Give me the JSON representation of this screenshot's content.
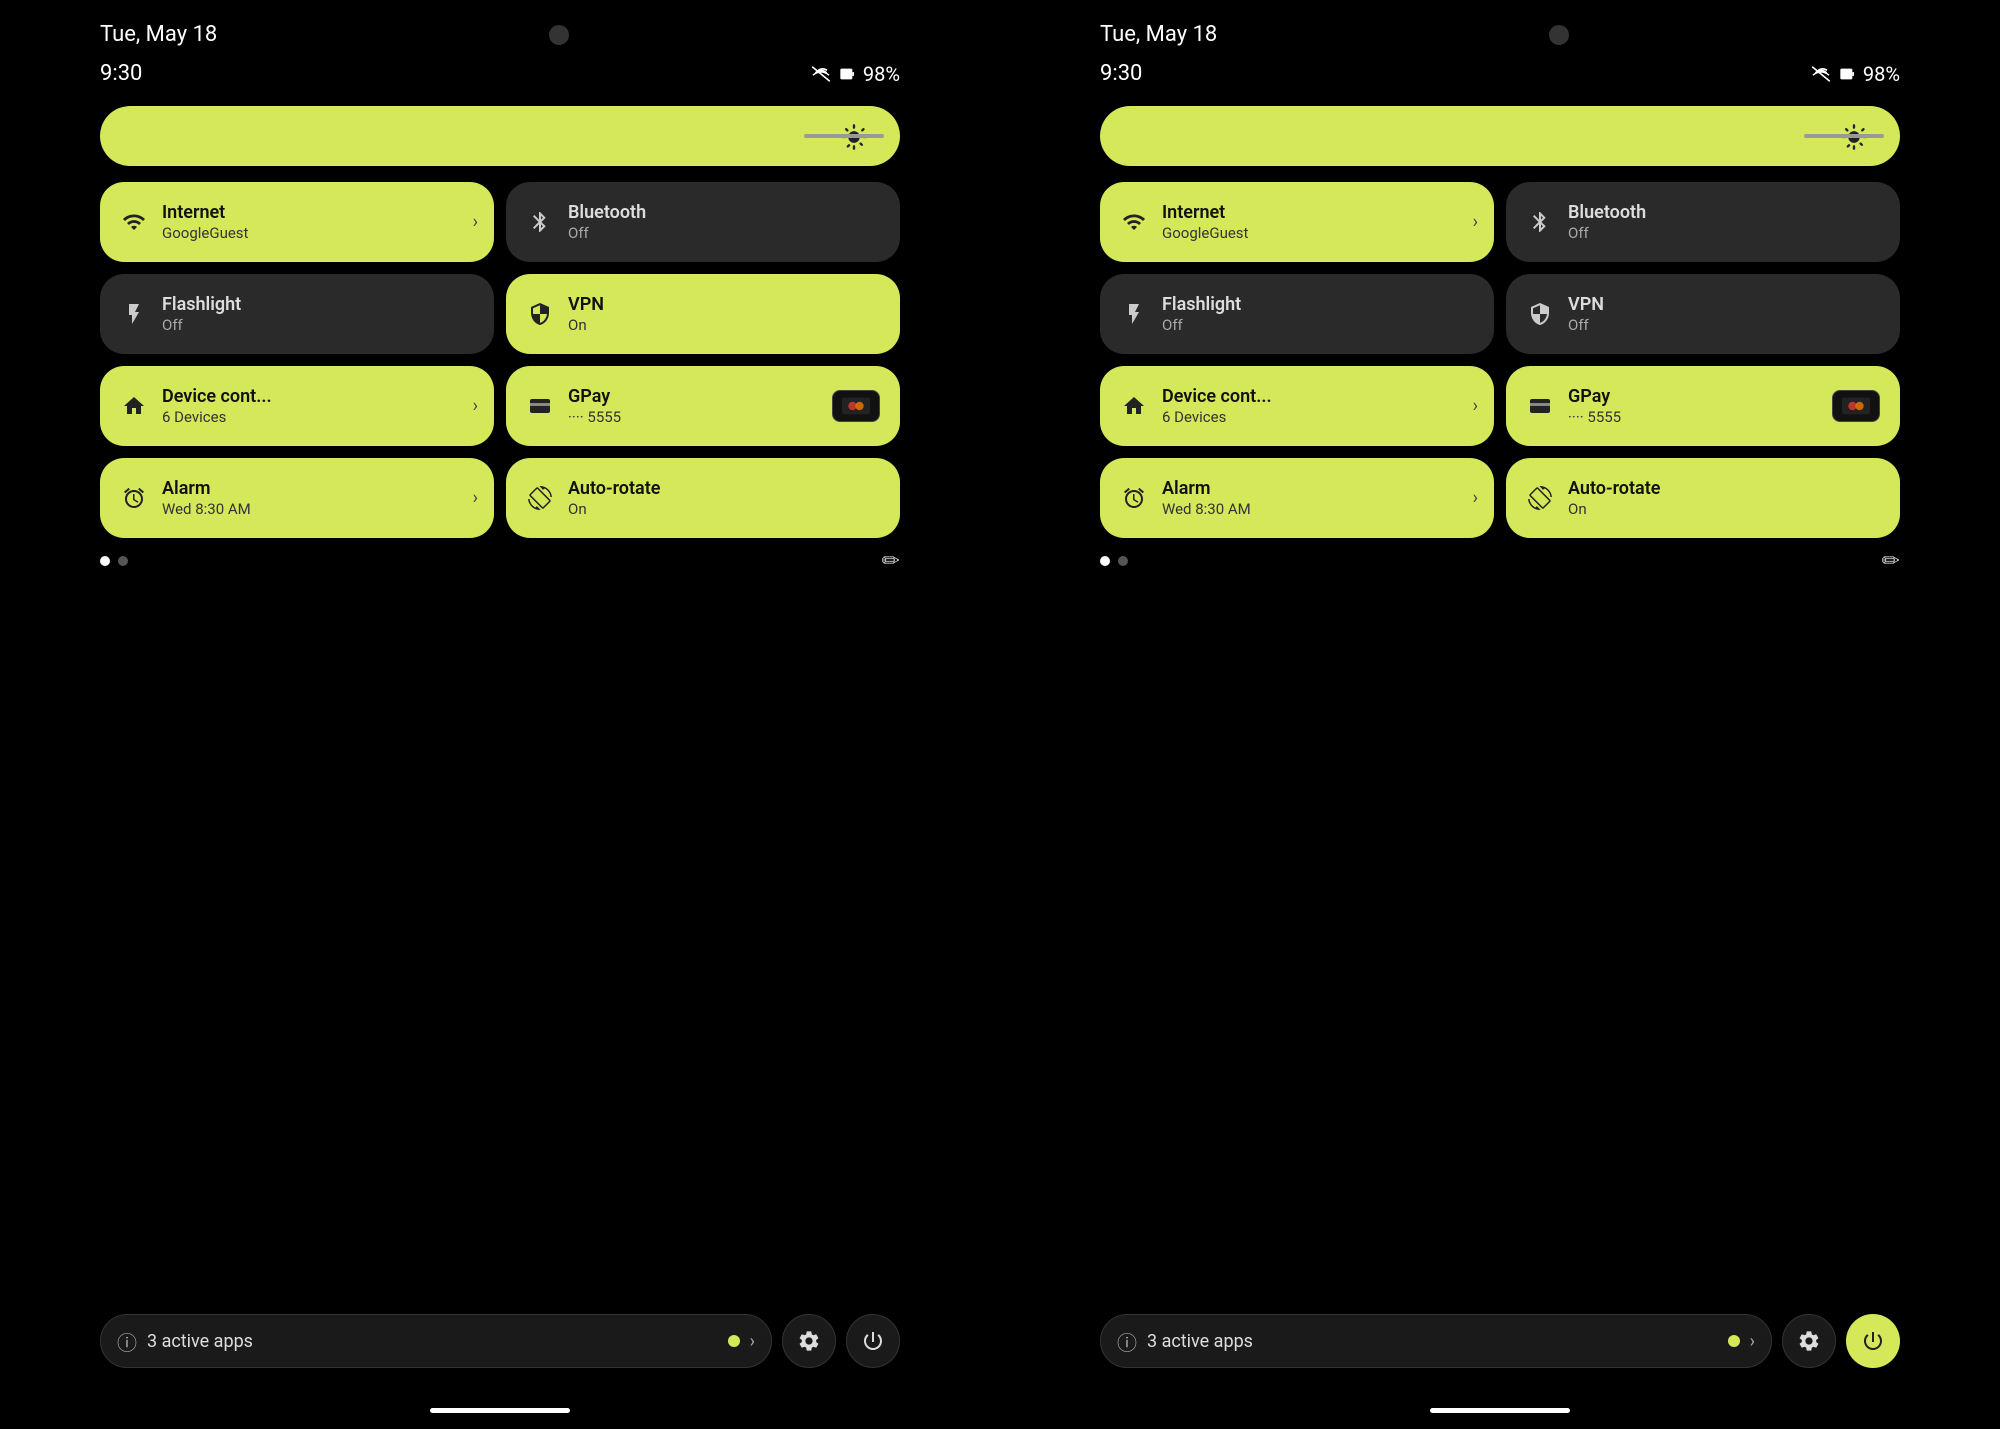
{
  "panels": [
    {
      "id": "left",
      "date": "Tue, May 18",
      "time": "9:30",
      "battery": "98%",
      "brightness": {
        "icon": "⚙"
      },
      "tiles": [
        {
          "id": "internet",
          "label": "Internet",
          "sublabel": "GoogleGuest",
          "state": "active",
          "hasArrow": true,
          "icon": "wifi"
        },
        {
          "id": "bluetooth",
          "label": "Bluetooth",
          "sublabel": "Off",
          "state": "inactive",
          "hasArrow": false,
          "icon": "bluetooth"
        },
        {
          "id": "flashlight",
          "label": "Flashlight",
          "sublabel": "Off",
          "state": "inactive",
          "hasArrow": false,
          "icon": "flashlight"
        },
        {
          "id": "vpn",
          "label": "VPN",
          "sublabel": "On",
          "state": "active",
          "hasArrow": false,
          "icon": "vpn"
        },
        {
          "id": "device",
          "label": "Device cont...",
          "sublabel": "6 Devices",
          "state": "active",
          "hasArrow": true,
          "icon": "device"
        },
        {
          "id": "gpay",
          "label": "GPay",
          "sublabel": "···· 5555",
          "state": "active",
          "hasArrow": false,
          "icon": "gpay",
          "card": true
        },
        {
          "id": "alarm",
          "label": "Alarm",
          "sublabel": "Wed 8:30 AM",
          "state": "active",
          "hasArrow": true,
          "icon": "alarm"
        },
        {
          "id": "autorotate",
          "label": "Auto-rotate",
          "sublabel": "On",
          "state": "active",
          "hasArrow": false,
          "icon": "autorotate"
        }
      ],
      "activeApps": "3 active apps",
      "powerActive": false
    },
    {
      "id": "right",
      "date": "Tue, May 18",
      "time": "9:30",
      "battery": "98%",
      "brightness": {
        "icon": "⚙"
      },
      "tiles": [
        {
          "id": "internet",
          "label": "Internet",
          "sublabel": "GoogleGuest",
          "state": "active",
          "hasArrow": true,
          "icon": "wifi"
        },
        {
          "id": "bluetooth",
          "label": "Bluetooth",
          "sublabel": "Off",
          "state": "inactive",
          "hasArrow": false,
          "icon": "bluetooth"
        },
        {
          "id": "flashlight",
          "label": "Flashlight",
          "sublabel": "Off",
          "state": "inactive",
          "hasArrow": false,
          "icon": "flashlight"
        },
        {
          "id": "vpn",
          "label": "VPN",
          "sublabel": "Off",
          "state": "inactive",
          "hasArrow": false,
          "icon": "vpn"
        },
        {
          "id": "device",
          "label": "Device cont...",
          "sublabel": "6 Devices",
          "state": "active",
          "hasArrow": true,
          "icon": "device"
        },
        {
          "id": "gpay",
          "label": "GPay",
          "sublabel": "···· 5555",
          "state": "active",
          "hasArrow": false,
          "icon": "gpay",
          "card": true
        },
        {
          "id": "alarm",
          "label": "Alarm",
          "sublabel": "Wed 8:30 AM",
          "state": "active",
          "hasArrow": true,
          "icon": "alarm"
        },
        {
          "id": "autorotate",
          "label": "Auto-rotate",
          "sublabel": "On",
          "state": "active",
          "hasArrow": false,
          "icon": "autorotate"
        }
      ],
      "activeApps": "3 active apps",
      "powerActive": true
    }
  ],
  "icons": {
    "wifi": "▾",
    "bluetooth": "✳",
    "flashlight": "🔦",
    "vpn": "🛡",
    "device": "🏠",
    "gpay": "💳",
    "alarm": "⏰",
    "autorotate": "↺",
    "info": "ⓘ",
    "settings": "⚙",
    "power": "⏻",
    "edit": "✏"
  }
}
